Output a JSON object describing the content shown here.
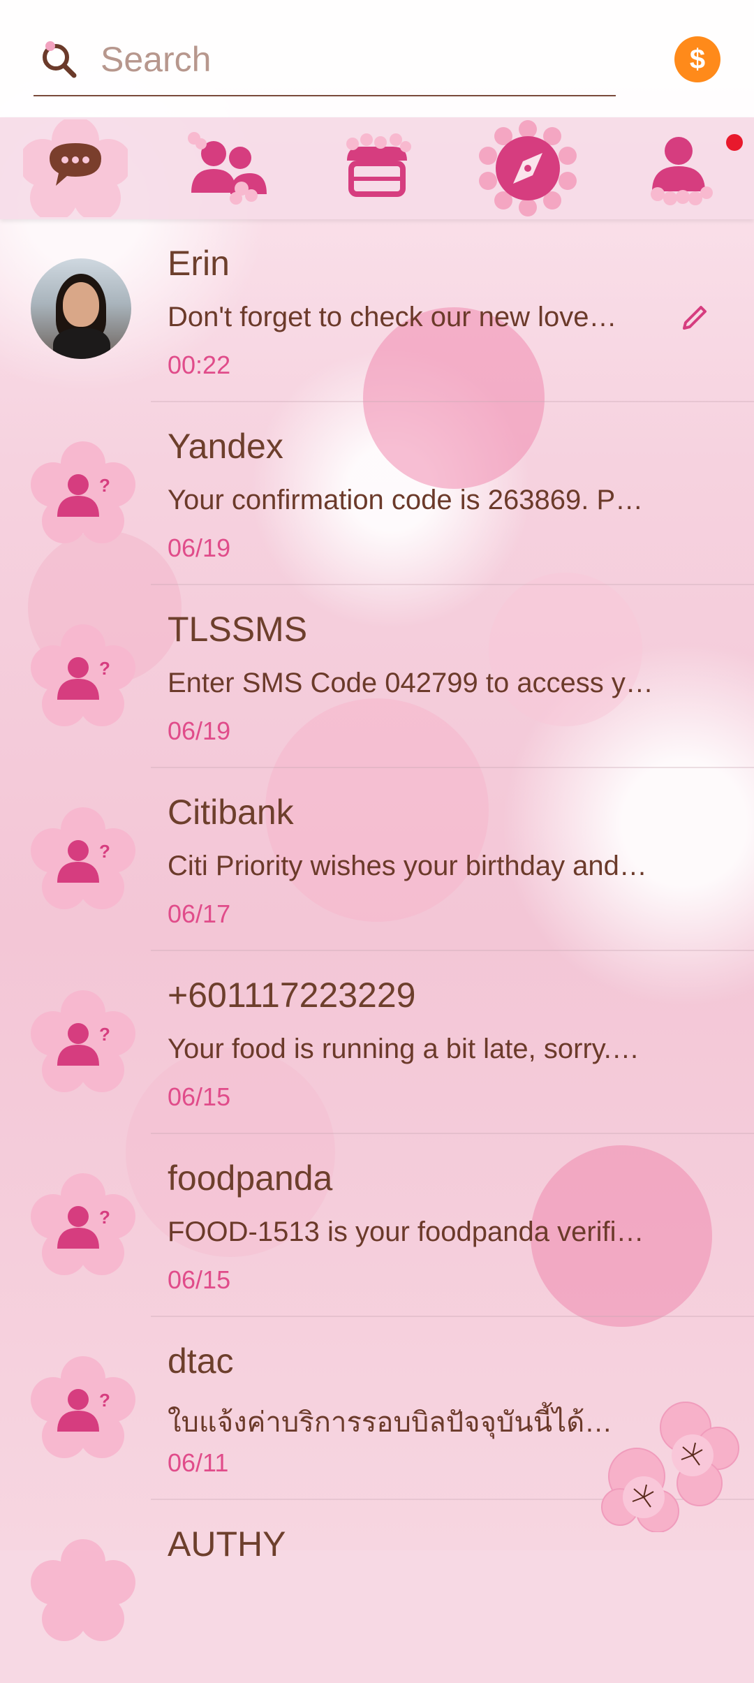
{
  "search": {
    "placeholder": "Search"
  },
  "coin_symbol": "$",
  "tabs": [
    {
      "icon": "chat-bubble-icon",
      "active": true
    },
    {
      "icon": "contacts-icon",
      "active": false
    },
    {
      "icon": "store-icon",
      "active": false
    },
    {
      "icon": "compass-icon",
      "active": false
    },
    {
      "icon": "profile-icon",
      "active": false,
      "notification": true
    }
  ],
  "conversations": [
    {
      "name": "Erin",
      "snippet": "Don't forget to check our new love…",
      "time": "00:22",
      "avatar": "photo",
      "draft": true
    },
    {
      "name": "Yandex",
      "snippet": "Your confirmation code is 263869. P…",
      "time": "06/19",
      "avatar": "unknown-contact"
    },
    {
      "name": "TLSSMS",
      "snippet": "Enter SMS Code 042799 to access y…",
      "time": "06/19",
      "avatar": "unknown-contact"
    },
    {
      "name": "Citibank",
      "snippet": "Citi Priority wishes your birthday and…",
      "time": "06/17",
      "avatar": "unknown-contact"
    },
    {
      "name": "+601117223229",
      "snippet": "Your food is running a bit late, sorry.…",
      "time": "06/15",
      "avatar": "unknown-contact"
    },
    {
      "name": "foodpanda",
      "snippet": "FOOD-1513 is your foodpanda verifi…",
      "time": "06/15",
      "avatar": "unknown-contact"
    },
    {
      "name": "dtac",
      "snippet": "ใบแจ้งค่าบริการรอบบิลปัจจุบันนี้ได้ท…",
      "time": "06/11",
      "avatar": "unknown-contact"
    },
    {
      "name": "AUTHY",
      "snippet": "",
      "time": "",
      "avatar": "unknown-contact"
    }
  ],
  "colors": {
    "accent": "#e04c8a",
    "text_brown": "#6d3f2c",
    "coin": "#ff8a1a",
    "notification": "#e8192c"
  }
}
